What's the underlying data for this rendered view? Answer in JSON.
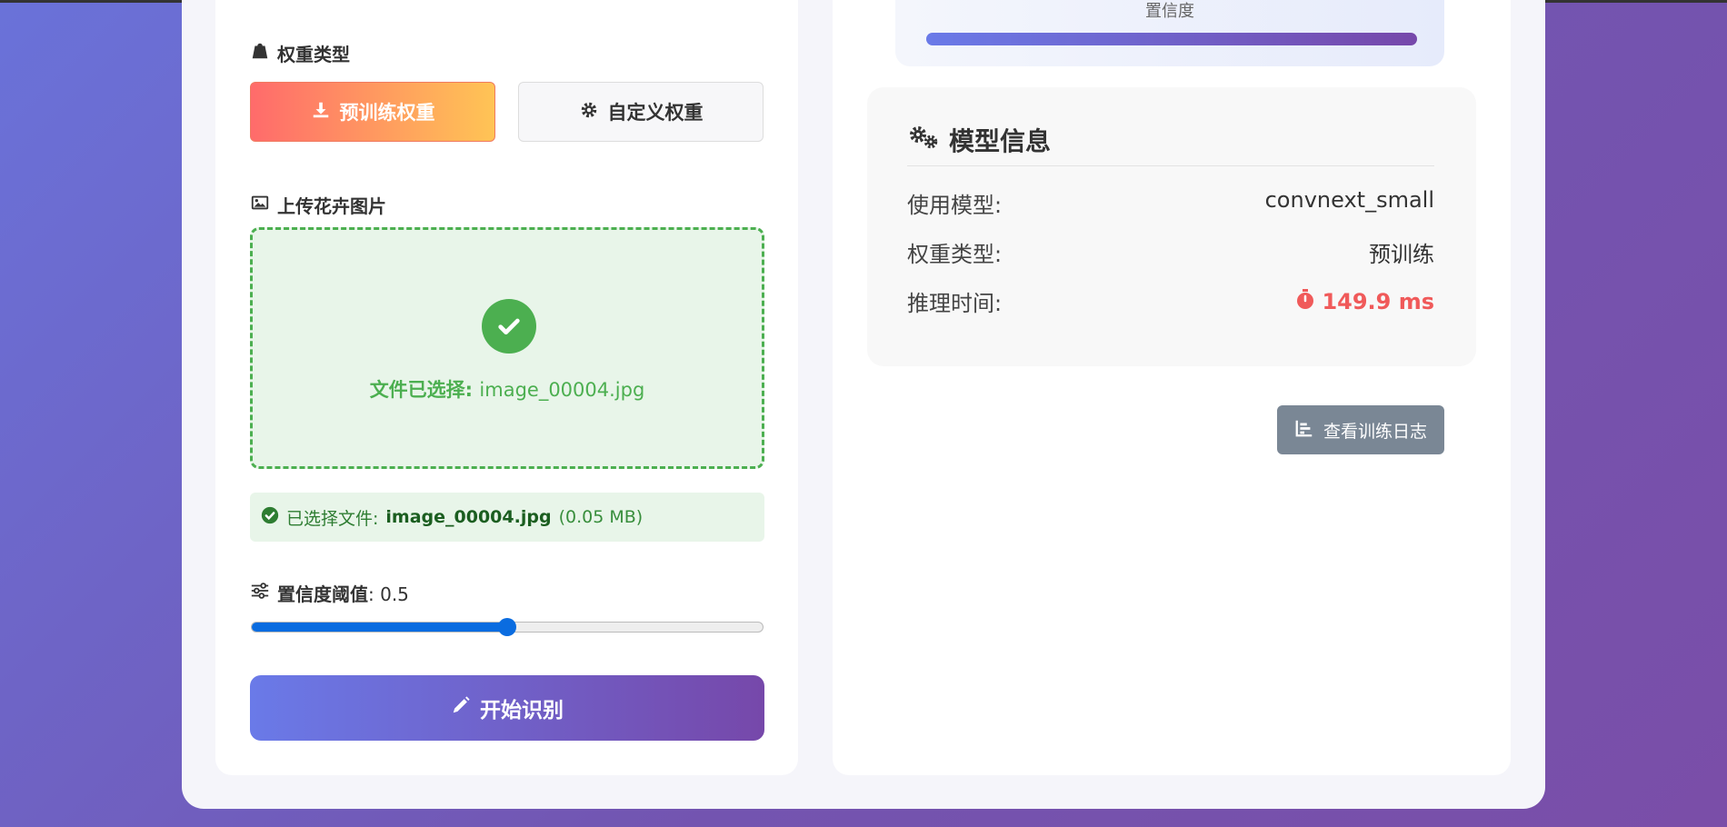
{
  "weight_type": {
    "label": "权重类型",
    "pretrained_label": "预训练权重",
    "custom_label": "自定义权重"
  },
  "upload": {
    "label": "上传花卉图片",
    "selected_prefix": "文件已选择:",
    "selected_filename": "image_00004.jpg"
  },
  "file_info": {
    "prefix": "已选择文件:",
    "filename": "image_00004.jpg",
    "size": "(0.05 MB)"
  },
  "threshold": {
    "label": "置信度阈值",
    "value_text": ": 0.5",
    "value": 0.5
  },
  "start_button": {
    "label": "开始识别"
  },
  "confidence": {
    "label": "置信度",
    "fill_fraction": 1.0
  },
  "model_info": {
    "title": "模型信息",
    "rows": [
      {
        "key": "使用模型:",
        "value": "convnext_small"
      },
      {
        "key": "权重类型:",
        "value": "预训练"
      },
      {
        "key": "推理时间:",
        "value": "149.9 ms"
      }
    ]
  },
  "log_button": {
    "label": "查看训练日志"
  },
  "colors": {
    "accent_green": "#4caf50",
    "accent_red": "#f05a5a",
    "accent_purple": "#7648aa"
  }
}
